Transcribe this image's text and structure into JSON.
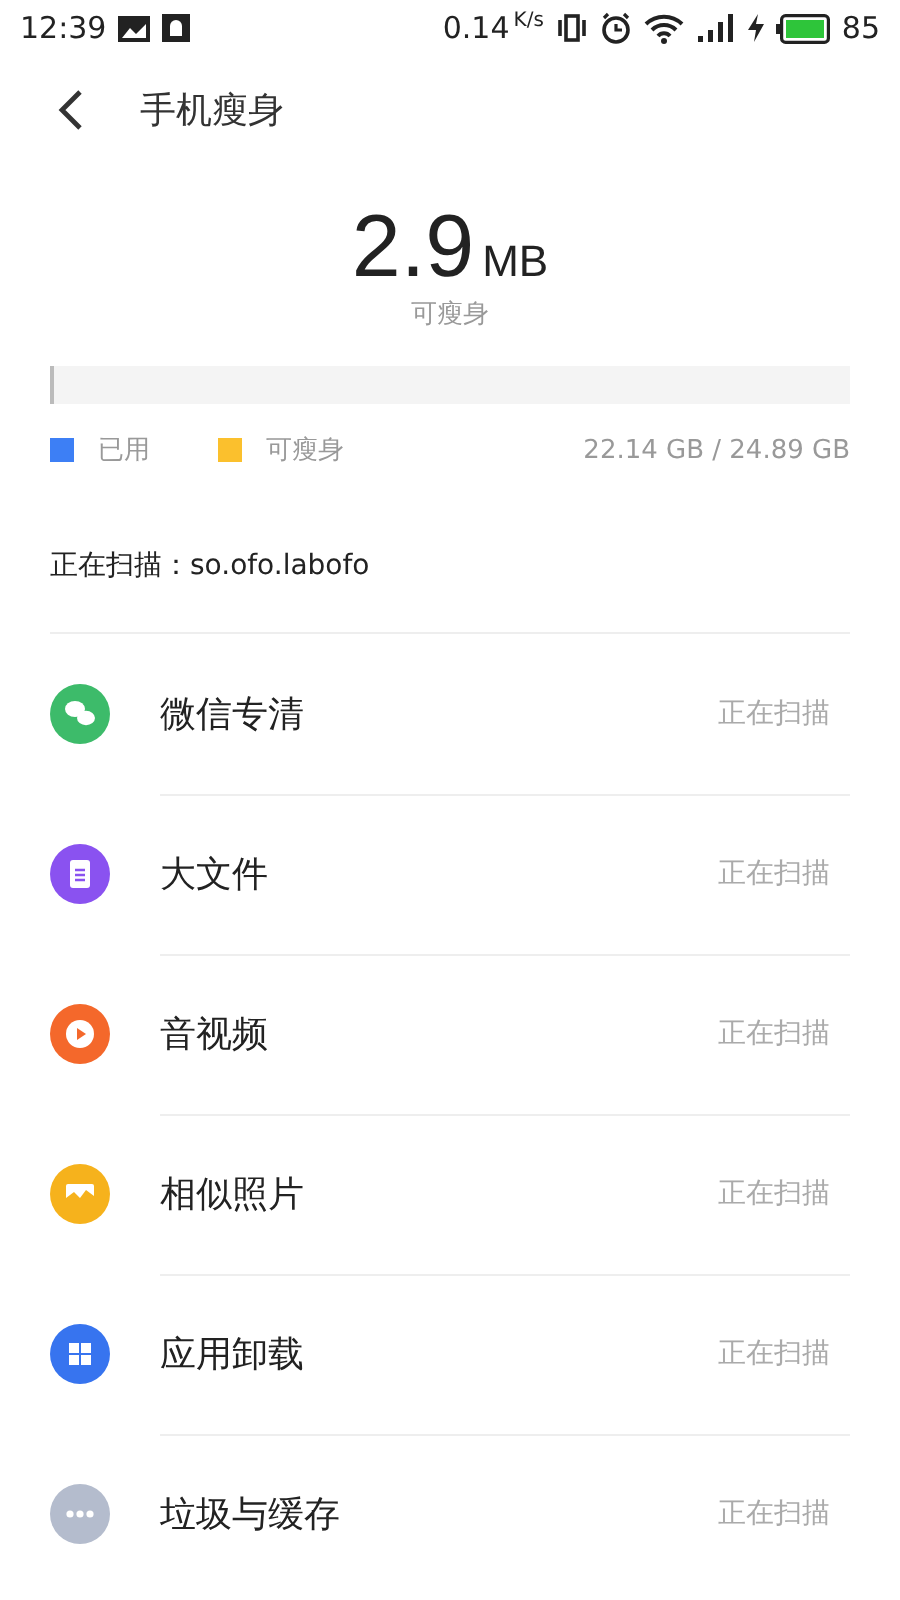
{
  "status_bar": {
    "time": "12:39",
    "speed": "0.14",
    "speed_unit": "K/s",
    "battery": "85"
  },
  "header": {
    "title": "手机瘦身"
  },
  "summary": {
    "amount": "2.9",
    "unit": "MB",
    "caption": "可瘦身"
  },
  "storage": {
    "level": 0.003,
    "legend": [
      {
        "label": "已用",
        "color": "#3d7ff5"
      },
      {
        "label": "可瘦身",
        "color": "#fbc02d"
      }
    ],
    "usage": "22.14 GB / 24.89 GB"
  },
  "scanning": "正在扫描：so.ofo.labofo",
  "items": [
    {
      "kind": "wechat",
      "label": "微信专清",
      "status": "正在扫描",
      "color": "#3dbb6a"
    },
    {
      "kind": "file",
      "label": "大文件",
      "status": "正在扫描",
      "color": "#8a52f0"
    },
    {
      "kind": "video",
      "label": "音视频",
      "status": "正在扫描",
      "color": "#f4682b"
    },
    {
      "kind": "photo",
      "label": "相似照片",
      "status": "正在扫描",
      "color": "#f6b21c"
    },
    {
      "kind": "apps",
      "label": "应用卸载",
      "status": "正在扫描",
      "color": "#3774ef"
    },
    {
      "kind": "more",
      "label": "垃圾与缓存",
      "status": "正在扫描",
      "color": "#b4bccd"
    }
  ]
}
